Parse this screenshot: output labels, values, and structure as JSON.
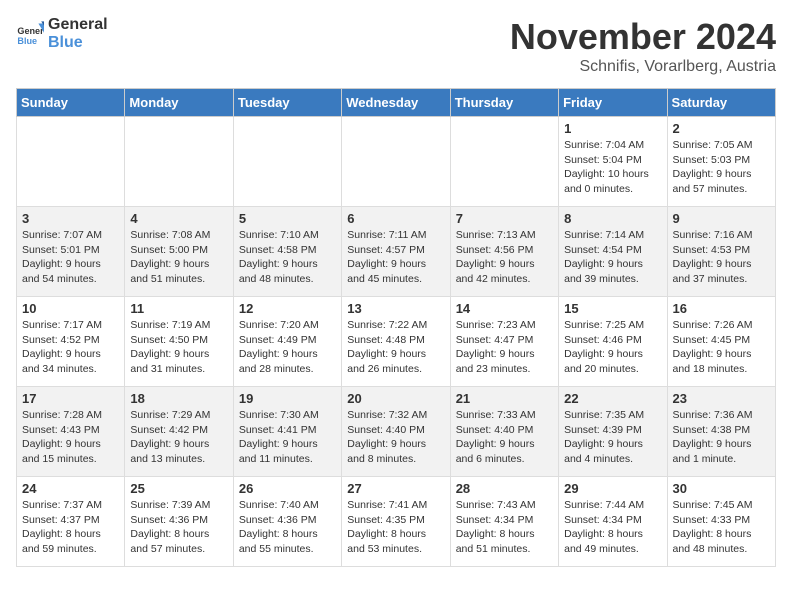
{
  "logo": {
    "general": "General",
    "blue": "Blue"
  },
  "header": {
    "month_year": "November 2024",
    "location": "Schnifis, Vorarlberg, Austria"
  },
  "days_of_week": [
    "Sunday",
    "Monday",
    "Tuesday",
    "Wednesday",
    "Thursday",
    "Friday",
    "Saturday"
  ],
  "weeks": [
    [
      {
        "day": "",
        "info": ""
      },
      {
        "day": "",
        "info": ""
      },
      {
        "day": "",
        "info": ""
      },
      {
        "day": "",
        "info": ""
      },
      {
        "day": "",
        "info": ""
      },
      {
        "day": "1",
        "info": "Sunrise: 7:04 AM\nSunset: 5:04 PM\nDaylight: 10 hours\nand 0 minutes."
      },
      {
        "day": "2",
        "info": "Sunrise: 7:05 AM\nSunset: 5:03 PM\nDaylight: 9 hours\nand 57 minutes."
      }
    ],
    [
      {
        "day": "3",
        "info": "Sunrise: 7:07 AM\nSunset: 5:01 PM\nDaylight: 9 hours\nand 54 minutes."
      },
      {
        "day": "4",
        "info": "Sunrise: 7:08 AM\nSunset: 5:00 PM\nDaylight: 9 hours\nand 51 minutes."
      },
      {
        "day": "5",
        "info": "Sunrise: 7:10 AM\nSunset: 4:58 PM\nDaylight: 9 hours\nand 48 minutes."
      },
      {
        "day": "6",
        "info": "Sunrise: 7:11 AM\nSunset: 4:57 PM\nDaylight: 9 hours\nand 45 minutes."
      },
      {
        "day": "7",
        "info": "Sunrise: 7:13 AM\nSunset: 4:56 PM\nDaylight: 9 hours\nand 42 minutes."
      },
      {
        "day": "8",
        "info": "Sunrise: 7:14 AM\nSunset: 4:54 PM\nDaylight: 9 hours\nand 39 minutes."
      },
      {
        "day": "9",
        "info": "Sunrise: 7:16 AM\nSunset: 4:53 PM\nDaylight: 9 hours\nand 37 minutes."
      }
    ],
    [
      {
        "day": "10",
        "info": "Sunrise: 7:17 AM\nSunset: 4:52 PM\nDaylight: 9 hours\nand 34 minutes."
      },
      {
        "day": "11",
        "info": "Sunrise: 7:19 AM\nSunset: 4:50 PM\nDaylight: 9 hours\nand 31 minutes."
      },
      {
        "day": "12",
        "info": "Sunrise: 7:20 AM\nSunset: 4:49 PM\nDaylight: 9 hours\nand 28 minutes."
      },
      {
        "day": "13",
        "info": "Sunrise: 7:22 AM\nSunset: 4:48 PM\nDaylight: 9 hours\nand 26 minutes."
      },
      {
        "day": "14",
        "info": "Sunrise: 7:23 AM\nSunset: 4:47 PM\nDaylight: 9 hours\nand 23 minutes."
      },
      {
        "day": "15",
        "info": "Sunrise: 7:25 AM\nSunset: 4:46 PM\nDaylight: 9 hours\nand 20 minutes."
      },
      {
        "day": "16",
        "info": "Sunrise: 7:26 AM\nSunset: 4:45 PM\nDaylight: 9 hours\nand 18 minutes."
      }
    ],
    [
      {
        "day": "17",
        "info": "Sunrise: 7:28 AM\nSunset: 4:43 PM\nDaylight: 9 hours\nand 15 minutes."
      },
      {
        "day": "18",
        "info": "Sunrise: 7:29 AM\nSunset: 4:42 PM\nDaylight: 9 hours\nand 13 minutes."
      },
      {
        "day": "19",
        "info": "Sunrise: 7:30 AM\nSunset: 4:41 PM\nDaylight: 9 hours\nand 11 minutes."
      },
      {
        "day": "20",
        "info": "Sunrise: 7:32 AM\nSunset: 4:40 PM\nDaylight: 9 hours\nand 8 minutes."
      },
      {
        "day": "21",
        "info": "Sunrise: 7:33 AM\nSunset: 4:40 PM\nDaylight: 9 hours\nand 6 minutes."
      },
      {
        "day": "22",
        "info": "Sunrise: 7:35 AM\nSunset: 4:39 PM\nDaylight: 9 hours\nand 4 minutes."
      },
      {
        "day": "23",
        "info": "Sunrise: 7:36 AM\nSunset: 4:38 PM\nDaylight: 9 hours\nand 1 minute."
      }
    ],
    [
      {
        "day": "24",
        "info": "Sunrise: 7:37 AM\nSunset: 4:37 PM\nDaylight: 8 hours\nand 59 minutes."
      },
      {
        "day": "25",
        "info": "Sunrise: 7:39 AM\nSunset: 4:36 PM\nDaylight: 8 hours\nand 57 minutes."
      },
      {
        "day": "26",
        "info": "Sunrise: 7:40 AM\nSunset: 4:36 PM\nDaylight: 8 hours\nand 55 minutes."
      },
      {
        "day": "27",
        "info": "Sunrise: 7:41 AM\nSunset: 4:35 PM\nDaylight: 8 hours\nand 53 minutes."
      },
      {
        "day": "28",
        "info": "Sunrise: 7:43 AM\nSunset: 4:34 PM\nDaylight: 8 hours\nand 51 minutes."
      },
      {
        "day": "29",
        "info": "Sunrise: 7:44 AM\nSunset: 4:34 PM\nDaylight: 8 hours\nand 49 minutes."
      },
      {
        "day": "30",
        "info": "Sunrise: 7:45 AM\nSunset: 4:33 PM\nDaylight: 8 hours\nand 48 minutes."
      }
    ]
  ]
}
